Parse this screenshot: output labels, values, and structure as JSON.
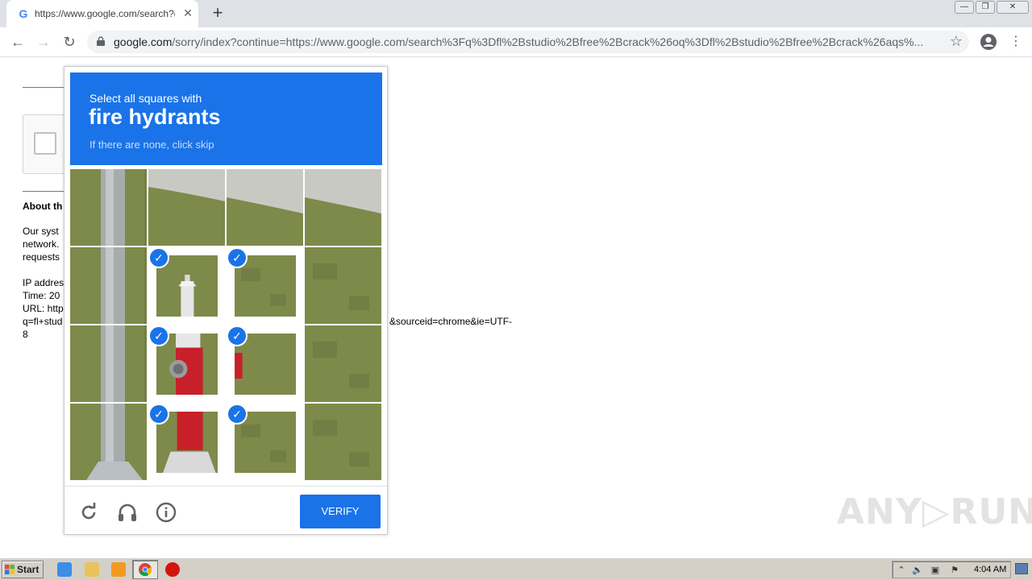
{
  "browser": {
    "tab_title": "https://www.google.com/search?q=",
    "favicon_letter": "G",
    "tab_close": "✕",
    "new_tab": "+",
    "win_min": "—",
    "win_restore": "❐",
    "win_close": "✕",
    "back": "←",
    "forward": "→",
    "reload": "↻",
    "url_host": "google.com",
    "url_path": "/sorry/index?continue=https://www.google.com/search%3Fq%3Dfl%2Bstudio%2Bfree%2Bcrack%26oq%3Dfl%2Bstudio%2Bfree%2Bcrack%26aqs%...",
    "star": "☆",
    "menu": "⋮"
  },
  "page": {
    "about_heading": "About th",
    "para_line1": "Our syst",
    "para_line2": "network.",
    "para_line3": "requests",
    "ip_line": "IP addres",
    "time_line": "Time: 20",
    "url_line": "URL: http",
    "url_line2": "q=fl+stud",
    "url_line2_tail": "&sourceid=chrome&ie=UTF-",
    "url_line3": "8",
    "watermark": "ANY▷RUN"
  },
  "captcha": {
    "instruction": "Select all squares with",
    "target": "fire hydrants",
    "hint": "If there are none, click skip",
    "verify_label": "VERIFY",
    "check_glyph": "✓",
    "tiles": [
      {
        "selected": false,
        "kind": "pole-grass"
      },
      {
        "selected": false,
        "kind": "grass-sidewalk"
      },
      {
        "selected": false,
        "kind": "sidewalk-grass"
      },
      {
        "selected": false,
        "kind": "sidewalk-grass"
      },
      {
        "selected": false,
        "kind": "pole-grass"
      },
      {
        "selected": true,
        "kind": "hydrant-top"
      },
      {
        "selected": true,
        "kind": "grass"
      },
      {
        "selected": false,
        "kind": "grass"
      },
      {
        "selected": false,
        "kind": "pole-grass"
      },
      {
        "selected": true,
        "kind": "hydrant-middle"
      },
      {
        "selected": true,
        "kind": "grass-red"
      },
      {
        "selected": false,
        "kind": "grass"
      },
      {
        "selected": false,
        "kind": "pole-base"
      },
      {
        "selected": true,
        "kind": "hydrant-base"
      },
      {
        "selected": true,
        "kind": "grass"
      },
      {
        "selected": false,
        "kind": "grass"
      }
    ],
    "colors": {
      "accent": "#1a73e8"
    }
  },
  "taskbar": {
    "start_label": "Start",
    "clock": "4:04 AM",
    "tray_expand": "⌃"
  }
}
